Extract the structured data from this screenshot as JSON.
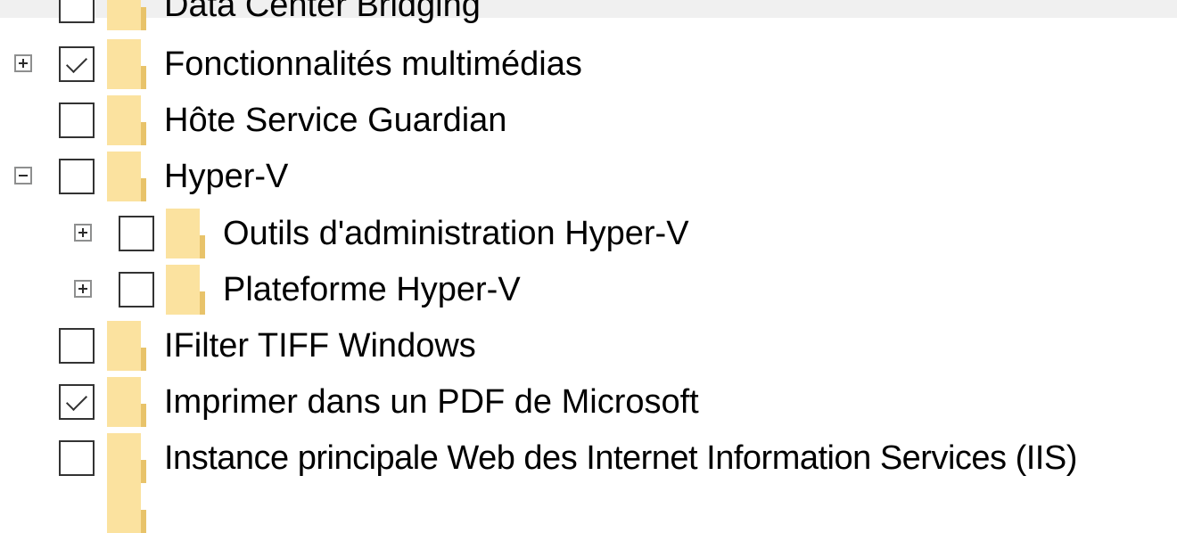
{
  "features": {
    "items": [
      {
        "label": "Data Center Bridging",
        "checked": false,
        "expander": "none"
      },
      {
        "label": "Fonctionnalités multimédias",
        "checked": true,
        "expander": "plus"
      },
      {
        "label": "Hôte Service Guardian",
        "checked": false,
        "expander": "none"
      },
      {
        "label": "Hyper-V",
        "checked": false,
        "expander": "minus"
      },
      {
        "label": "Outils d'administration Hyper-V",
        "checked": false,
        "expander": "plus"
      },
      {
        "label": "Plateforme Hyper-V",
        "checked": false,
        "expander": "plus"
      },
      {
        "label": "IFilter TIFF Windows",
        "checked": false,
        "expander": "none"
      },
      {
        "label": "Imprimer dans un PDF de Microsoft",
        "checked": true,
        "expander": "none"
      },
      {
        "label": "Instance principale Web des Internet Information Services (IIS)",
        "checked": false,
        "expander": "none"
      }
    ]
  },
  "colors": {
    "folder_front": "#fbe29f",
    "folder_back": "#e8c36a",
    "checkbox_border": "#333333",
    "expander_border": "#8e8f8f"
  }
}
